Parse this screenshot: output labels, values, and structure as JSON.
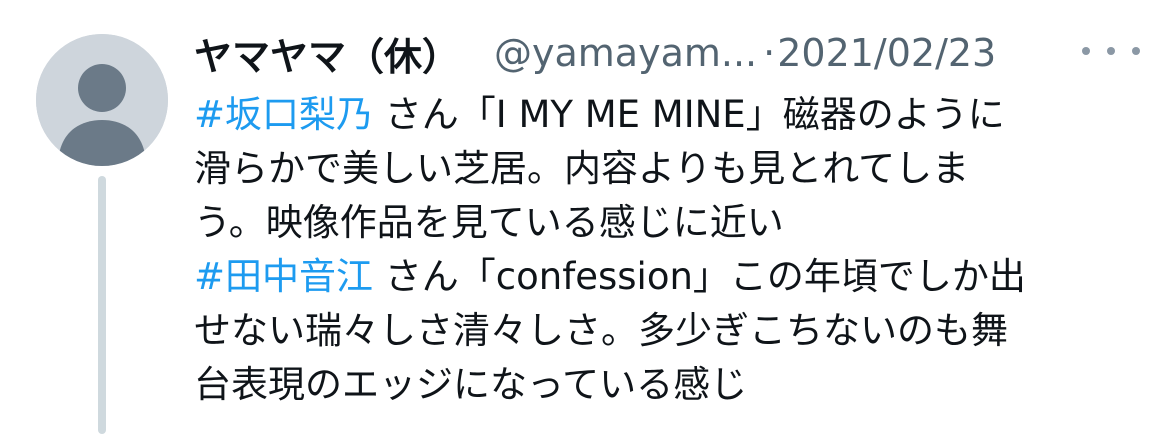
{
  "tweet": {
    "display_name": "ヤマヤマ（休）",
    "handle": "@yamayam...",
    "separator": "·",
    "date": "2021/02/23",
    "more_label": "•••",
    "lines": [
      {
        "hashtag": "#坂口梨乃",
        "text": " さん「I MY ME MINE」磁器のように"
      },
      {
        "hashtag": "",
        "text": "滑らかで美しい芝居。内容よりも見とれてしま"
      },
      {
        "hashtag": "",
        "text": "う。映像作品を見ている感じに近い"
      },
      {
        "hashtag": "#田中音江",
        "text": " さん「confession」この年頃でしか出"
      },
      {
        "hashtag": "",
        "text": "せない瑞々しさ清々しさ。多少ぎこちないのも舞"
      },
      {
        "hashtag": "",
        "text": "台表現のエッジになっている感じ"
      }
    ]
  },
  "colors": {
    "hashtag": "#1d9bf0",
    "text": "#0f1419",
    "secondary": "#536471",
    "avatar_bg": "#ced5dc",
    "avatar_fg": "#6b7a88",
    "thread_line": "#cfd9de"
  },
  "icons": {
    "avatar": "default-profile-icon",
    "more": "more-horizontal-icon"
  }
}
